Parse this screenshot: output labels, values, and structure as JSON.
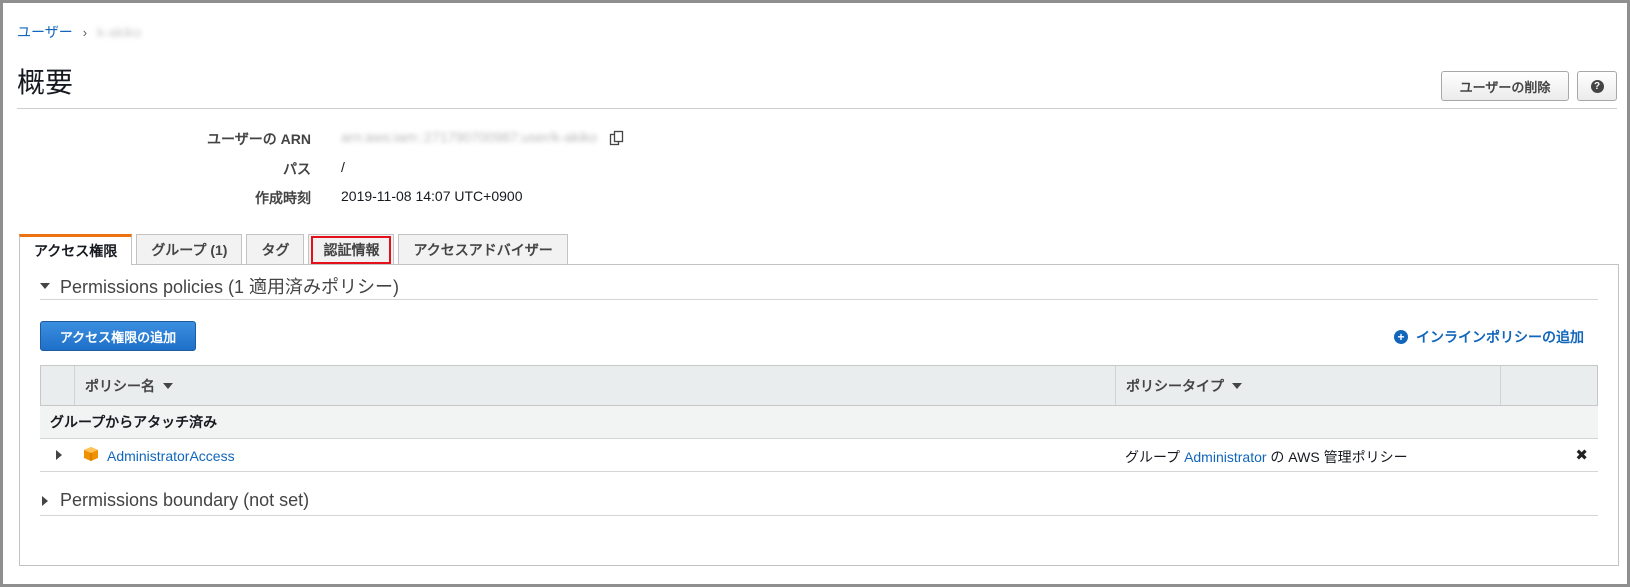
{
  "breadcrumb": {
    "parent": "ユーザー",
    "separator": "›",
    "current": "k-akiko"
  },
  "page": {
    "title": "概要"
  },
  "header_buttons": {
    "delete_user": "ユーザーの削除",
    "help": "?"
  },
  "summary": {
    "arn_label": "ユーザーの ARN",
    "arn_value": "arn:aws:iam::271790700987:user/k-akiko",
    "path_label": "パス",
    "path_value": "/",
    "created_label": "作成時刻",
    "created_value": "2019-11-08 14:07 UTC+0900"
  },
  "tabs": [
    {
      "label": "アクセス権限",
      "active": true
    },
    {
      "label": "グループ (1)",
      "active": false
    },
    {
      "label": "タグ",
      "active": false
    },
    {
      "label": "認証情報",
      "active": false,
      "highlighted": true
    },
    {
      "label": "アクセスアドバイザー",
      "active": false
    }
  ],
  "permissions": {
    "section_title": "Permissions policies (1 適用済みポリシー)",
    "add_button": "アクセス権限の追加",
    "inline_link": "インラインポリシーの追加",
    "columns": {
      "policy_name": "ポリシー名",
      "policy_type": "ポリシータイプ"
    },
    "group_label": "グループからアタッチ済み",
    "rows": [
      {
        "name": "AdministratorAccess",
        "type_prefix": "グループ",
        "type_link": "Administrator",
        "type_suffix": "の AWS 管理ポリシー",
        "remove": "✖"
      }
    ]
  },
  "boundary": {
    "section_title": "Permissions boundary (not set)"
  },
  "colors": {
    "link": "#1166bb",
    "active_tab_accent": "#ec7211",
    "primary_button": "#1f6fc8",
    "highlight_box": "#e5101a",
    "policy_icon": "#f29100"
  }
}
